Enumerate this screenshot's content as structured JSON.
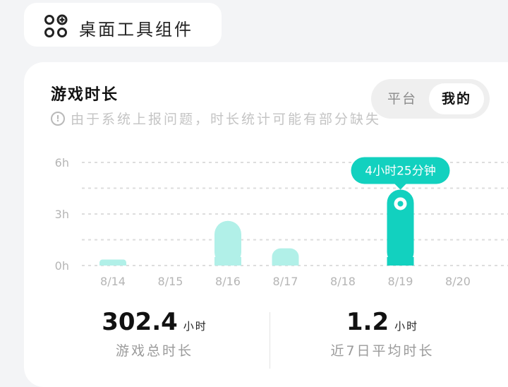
{
  "widget": {
    "label": "桌面工具组件",
    "icon": "apps-add-icon"
  },
  "card": {
    "title": "游戏时长",
    "notice": "由于系统上报问题，时长统计可能有部分缺失",
    "segment": {
      "options": [
        "平台",
        "我的"
      ],
      "selected": "我的"
    }
  },
  "chart_data": {
    "type": "bar",
    "categories": [
      "8/14",
      "8/15",
      "8/16",
      "8/17",
      "8/18",
      "8/19",
      "8/20"
    ],
    "values": [
      0.35,
      0,
      2.6,
      1.0,
      0,
      4.42,
      0
    ],
    "ylim": [
      0,
      6
    ],
    "yticks": [
      "0h",
      "3h",
      "6h"
    ],
    "highlight_index": 5,
    "tooltip": "4小时25分钟",
    "colors": {
      "bar": "#b1f0e8",
      "highlight": "#12d1bf",
      "grid": "#dddddd",
      "tick": "#b5b5b5"
    }
  },
  "stats": {
    "total": {
      "value": "302.4",
      "unit": "小时",
      "label": "游戏总时长"
    },
    "avg": {
      "value": "1.2",
      "unit": "小时",
      "label": "近7日平均时长"
    }
  }
}
